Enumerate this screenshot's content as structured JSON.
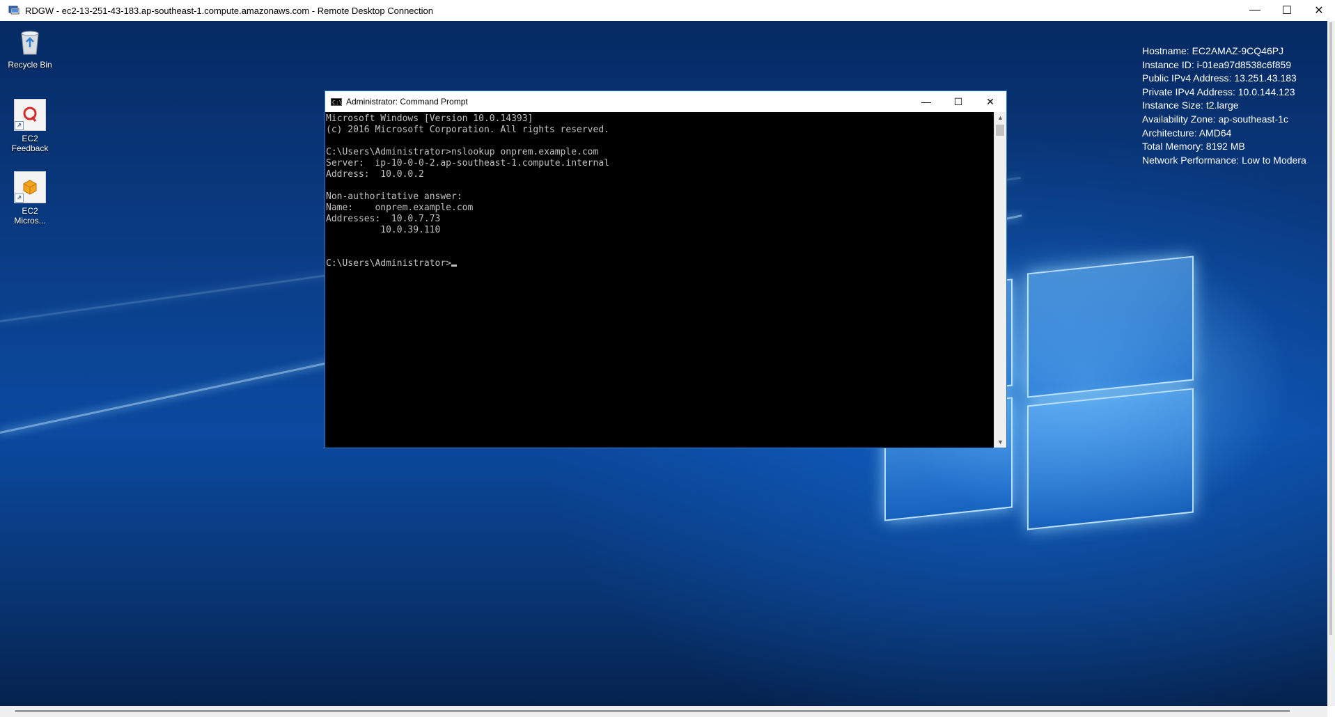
{
  "rdp": {
    "title": "RDGW - ec2-13-251-43-183.ap-southeast-1.compute.amazonaws.com - Remote Desktop Connection",
    "minimize": "—",
    "maximize": "☐",
    "close": "✕"
  },
  "desktop_icons": [
    {
      "label": "Recycle Bin"
    },
    {
      "label": "EC2\nFeedback"
    },
    {
      "label": "EC2\nMicros..."
    }
  ],
  "system_info": [
    "Hostname: EC2AMAZ-9CQ46PJ",
    "Instance ID: i-01ea97d8538c6f859",
    "Public IPv4 Address: 13.251.43.183",
    "Private IPv4 Address: 10.0.144.123",
    "Instance Size: t2.large",
    "Availability Zone: ap-southeast-1c",
    "Architecture: AMD64",
    "Total Memory: 8192 MB",
    "Network Performance: Low to Modera"
  ],
  "cmd": {
    "title": "Administrator: Command Prompt",
    "icon_text": "C:\\",
    "minimize": "—",
    "maximize": "☐",
    "close": "✕",
    "lines": [
      "Microsoft Windows [Version 10.0.14393]",
      "(c) 2016 Microsoft Corporation. All rights reserved.",
      "",
      "C:\\Users\\Administrator>nslookup onprem.example.com",
      "Server:  ip-10-0-0-2.ap-southeast-1.compute.internal",
      "Address:  10.0.0.2",
      "",
      "Non-authoritative answer:",
      "Name:    onprem.example.com",
      "Addresses:  10.0.7.73",
      "          10.0.39.110",
      "",
      ""
    ],
    "prompt": "C:\\Users\\Administrator>"
  }
}
